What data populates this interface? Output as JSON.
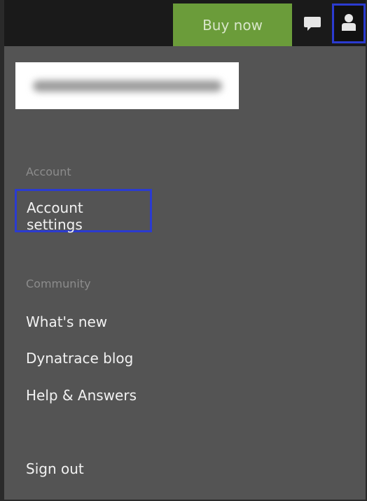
{
  "header": {
    "buy_now_label": "Buy now",
    "chat_icon": "chat-bubble-icon",
    "user_icon": "user-icon"
  },
  "user": {
    "display_name_blurred": true
  },
  "menu": {
    "account_section_title": "Account",
    "account_settings": "Account settings",
    "community_section_title": "Community",
    "whats_new": "What's new",
    "dynatrace_blog": "Dynatrace blog",
    "help_answers": "Help & Answers",
    "sign_out": "Sign out"
  },
  "colors": {
    "buy_now_bg": "#6b9c3a",
    "highlight_border": "#2b3bd0",
    "panel_bg": "#545454"
  }
}
